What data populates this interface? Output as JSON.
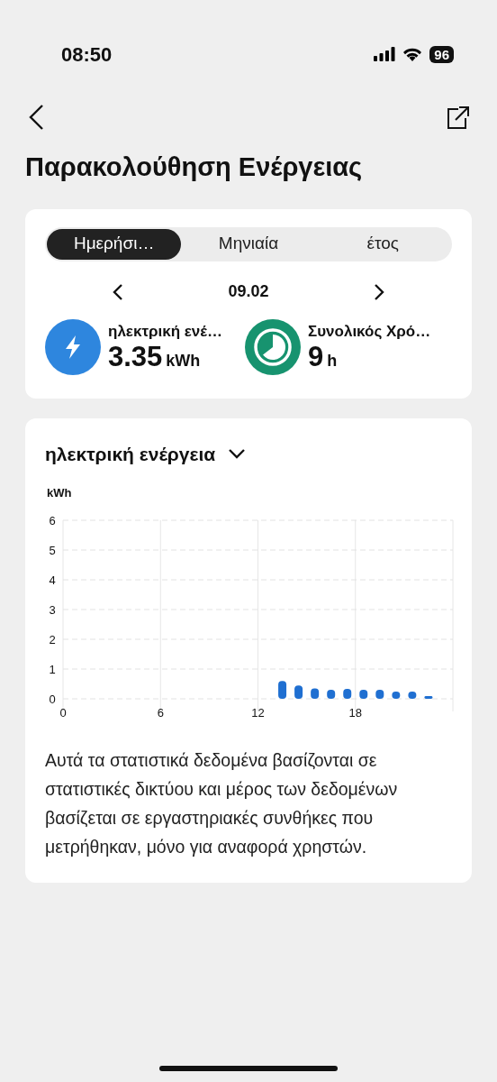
{
  "status_bar": {
    "time": "08:50",
    "battery": "96"
  },
  "title": "Παρακολούθηση Ενέργειας",
  "tabs": [
    {
      "label": "Ημερήσι…",
      "selected": true
    },
    {
      "label": "Μηνιαία",
      "selected": false
    },
    {
      "label": "έτος",
      "selected": false
    }
  ],
  "date": "09.02",
  "stats": [
    {
      "kind": "energy",
      "color": "#2e86de",
      "label": "ηλεκτρική ενέ…",
      "value": "3.35",
      "unit": "kWh"
    },
    {
      "kind": "time",
      "color": "#17936f",
      "label": "Συνολικός Χρό…",
      "value": "9",
      "unit": "h"
    }
  ],
  "chart_card": {
    "selector": "ηλεκτρική ενέργεια",
    "chart_data": {
      "type": "bar",
      "ylabel": "kWh",
      "x": [
        13.5,
        14.5,
        15.5,
        16.5,
        17.5,
        18.5,
        19.5,
        20.5,
        21.5,
        22.5
      ],
      "series": [
        {
          "color": "#1f6fd1",
          "values": [
            0.6,
            0.45,
            0.35,
            0.3,
            0.33,
            0.3,
            0.3,
            0.24,
            0.24,
            0.09
          ]
        }
      ],
      "xlim": [
        0,
        24
      ],
      "ylim": [
        0,
        6
      ],
      "yticks": [
        0,
        1,
        2,
        3,
        4,
        5,
        6
      ],
      "grid": true,
      "xticks": [
        {
          "value": 0,
          "label": "0"
        },
        {
          "value": 6,
          "label": "6"
        },
        {
          "value": 12,
          "label": "12"
        },
        {
          "value": 18,
          "label": "18"
        }
      ]
    },
    "note": "Αυτά τα στατιστικά δεδομένα βασίζονται σε στατιστικές δικτύου και μέρος των δεδομένων βασίζεται σε εργαστηριακές συνθήκες που μετρήθηκαν, μόνο για αναφορά χρηστών."
  }
}
